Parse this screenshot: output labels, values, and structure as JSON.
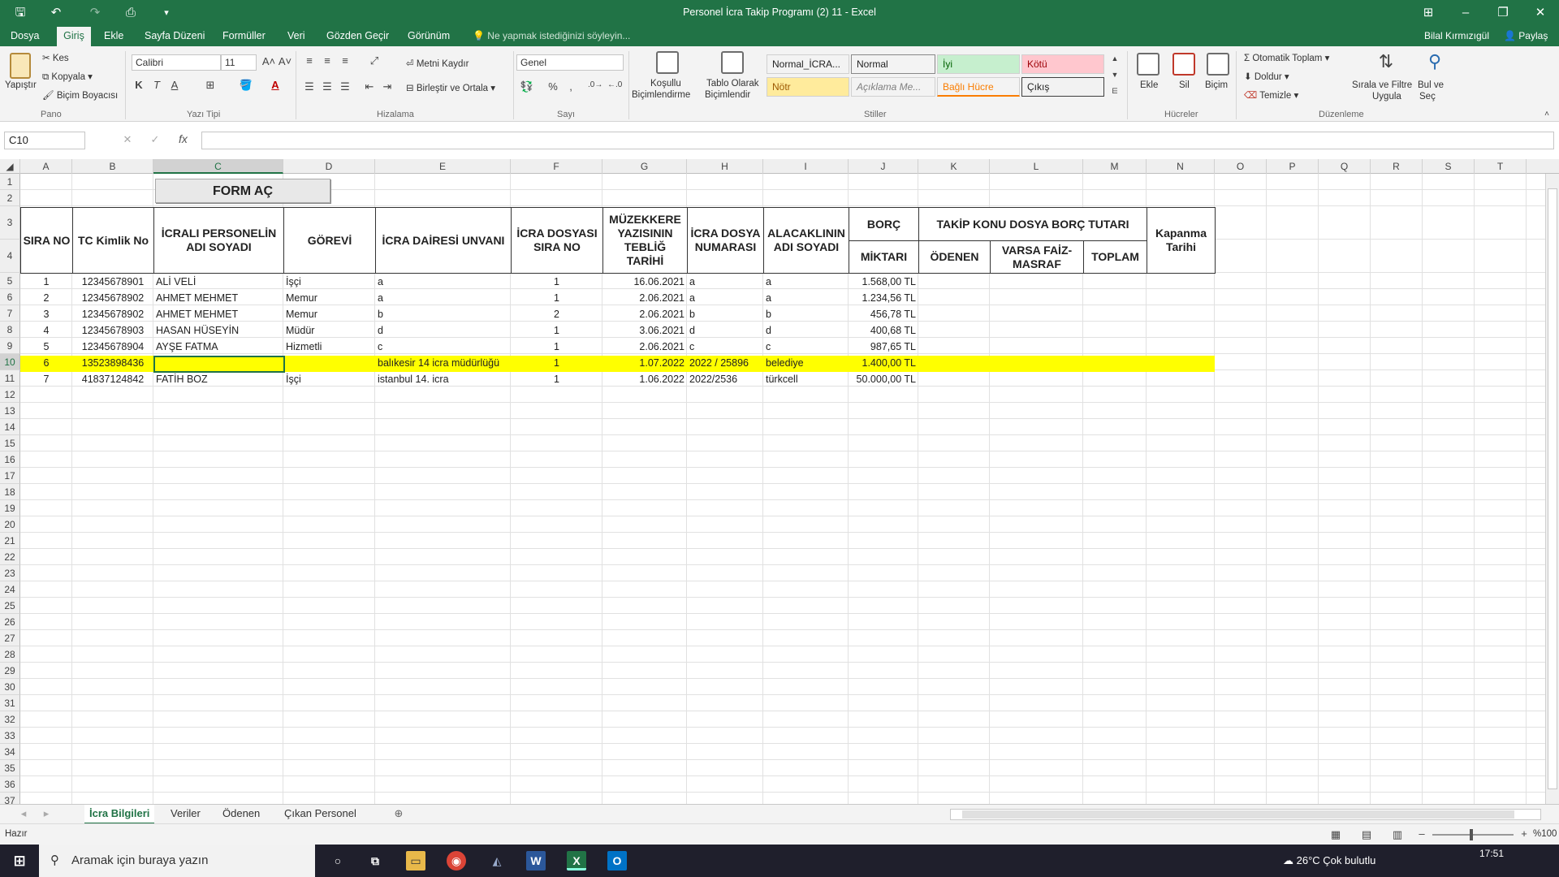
{
  "window": {
    "title": "Personel İcra Takip Programı (2)  11  -  Excel",
    "quick_access": {
      "save": "save-icon",
      "undo": "undo-icon",
      "redo": "redo-icon",
      "preview": "print-preview-icon"
    }
  },
  "ribbon_tabs": [
    "Dosya",
    "Giriş",
    "Ekle",
    "Sayfa Düzeni",
    "Formüller",
    "Veri",
    "Gözden Geçir",
    "Görünüm"
  ],
  "tell_me": "Ne yapmak istediğinizi söyleyin...",
  "user": {
    "name": "Bilal Kırmızıgül",
    "share": "Paylaş"
  },
  "ribbon": {
    "clipboard": {
      "paste": "Yapıştır",
      "cut": "Kes",
      "copy": "Kopyala",
      "format_painter": "Biçim Boyacısı",
      "label": "Pano"
    },
    "font": {
      "name": "Calibri",
      "size": "11",
      "bold": "K",
      "italic": "T",
      "underline": "A",
      "label": "Yazı Tipi"
    },
    "alignment": {
      "wrap": "Metni Kaydır",
      "merge": "Birleştir ve Ortala",
      "label": "Hizalama"
    },
    "number": {
      "format": "Genel",
      "percent": "%",
      "comma": ",",
      "label": "Sayı"
    },
    "styles": {
      "conditional": "Koşullu\nBiçimlendirme",
      "conditional_l1": "Koşullu",
      "conditional_l2": "Biçimlendirme",
      "table_l1": "Tablo Olarak",
      "table_l2": "Biçimlendir",
      "cells": [
        {
          "label": "Normal_İCRA...",
          "bg": "#ffffff"
        },
        {
          "label": "Normal",
          "bg": "#ffffff"
        },
        {
          "label": "İyi",
          "bg": "#c6efce",
          "color": "#006100"
        },
        {
          "label": "Kötü",
          "bg": "#ffc7ce",
          "color": "#9c0006"
        },
        {
          "label": "Nötr",
          "bg": "#ffeb9c",
          "color": "#9c5700"
        },
        {
          "label": "Açıklama Me...",
          "bg": "#ffffff",
          "color": "#7f7f7f"
        },
        {
          "label": "Bağlı Hücre",
          "bg": "#ffffff",
          "color": "#fa7d00"
        },
        {
          "label": "Çıkış",
          "bg": "#f2f2f2",
          "color": "#3f3f3f"
        }
      ],
      "label": "Stiller"
    },
    "cells": {
      "insert": "Ekle",
      "delete": "Sil",
      "format": "Biçim",
      "label": "Hücreler"
    },
    "editing": {
      "autosum": "Otomatik Toplam",
      "fill": "Doldur",
      "clear": "Temizle",
      "sort_l1": "Sırala ve Filtre",
      "sort_l2": "Uygula",
      "find_l1": "Bul ve",
      "find_l2": "Seç",
      "label": "Düzenleme"
    }
  },
  "formula_bar": {
    "name_box": "C10",
    "fx": "fx",
    "value": ""
  },
  "columns": [
    "A",
    "B",
    "C",
    "D",
    "E",
    "F",
    "G",
    "H",
    "I",
    "J",
    "K",
    "L",
    "M",
    "N",
    "O",
    "P",
    "Q",
    "R",
    "S",
    "T"
  ],
  "form_button": "FORM AÇ",
  "headers": {
    "sira_no": "SIRA NO",
    "tc": "TC Kimlik No",
    "personel": "İCRALI PERSONELİN ADI SOYADI",
    "gorevi": "GÖREVİ",
    "daire": "İCRA DAİRESİ UNVANI",
    "dosya_sira": "İCRA DOSYASI SIRA NO",
    "muzekkere": "MÜZEKKERE YAZISININ TEBLİĞ TARİHİ",
    "dosya_no": "İCRA DOSYA NUMARASI",
    "alacakli": "ALACAKLININ ADI SOYADI",
    "borc": "BORÇ",
    "miktar": "MİKTARI",
    "takip": "TAKİP KONU DOSYA BORÇ TUTARI",
    "odenen": "ÖDENEN",
    "faiz": "VARSA FAİZ-MASRAF",
    "toplam": "TOPLAM",
    "kapanma": "Kapanma Tarihi"
  },
  "rows": [
    {
      "sira": "1",
      "tc": "12345678901",
      "ad": "ALİ VELİ",
      "gorev": "İşçi",
      "daire": "a",
      "dsira": "1",
      "tarih": "16.06.2021",
      "dno": "a",
      "alacakli": "a",
      "borc": "1.568,00 TL"
    },
    {
      "sira": "2",
      "tc": "12345678902",
      "ad": "AHMET MEHMET",
      "gorev": "Memur",
      "daire": "a",
      "dsira": "1",
      "tarih": "2.06.2021",
      "dno": "a",
      "alacakli": "a",
      "borc": "1.234,56 TL"
    },
    {
      "sira": "3",
      "tc": "12345678902",
      "ad": "AHMET MEHMET",
      "gorev": "Memur",
      "daire": "b",
      "dsira": "2",
      "tarih": "2.06.2021",
      "dno": "b",
      "alacakli": "b",
      "borc": "456,78 TL"
    },
    {
      "sira": "4",
      "tc": "12345678903",
      "ad": "HASAN HÜSEYİN",
      "gorev": "Müdür",
      "daire": "d",
      "dsira": "1",
      "tarih": "3.06.2021",
      "dno": "d",
      "alacakli": "d",
      "borc": "400,68 TL"
    },
    {
      "sira": "5",
      "tc": "12345678904",
      "ad": "AYŞE FATMA",
      "gorev": "Hizmetli",
      "daire": "c",
      "dsira": "1",
      "tarih": "2.06.2021",
      "dno": "c",
      "alacakli": "c",
      "borc": "987,65 TL"
    },
    {
      "sira": "6",
      "tc": "13523898436",
      "ad": "",
      "gorev": "",
      "daire": "balıkesir 14 icra müdürlüğü",
      "dsira": "1",
      "tarih": "1.07.2022",
      "dno": "2022 / 25896",
      "alacakli": "belediye",
      "borc": "1.400,00 TL"
    },
    {
      "sira": "7",
      "tc": "41837124842",
      "ad": "FATİH BOZ",
      "gorev": "İşçi",
      "daire": "istanbul 14. icra",
      "dsira": "1",
      "tarih": "1.06.2022",
      "dno": "2022/2536",
      "alacakli": "türkcell",
      "borc": "50.000,00 TL"
    }
  ],
  "row_numbers": [
    "1",
    "2",
    "3",
    "4",
    "5",
    "6",
    "7",
    "8",
    "9",
    "10",
    "11",
    "12",
    "13",
    "14",
    "15",
    "16",
    "17",
    "18",
    "19",
    "20",
    "21",
    "22",
    "23",
    "24",
    "25",
    "26",
    "27",
    "28",
    "29",
    "30",
    "31",
    "32",
    "33",
    "34",
    "35",
    "36",
    "37"
  ],
  "sheet_tabs": [
    "İcra Bilgileri",
    "Veriler",
    "Ödenen",
    "Çıkan Personel"
  ],
  "status": {
    "ready": "Hazır",
    "zoom": "%100"
  },
  "taskbar": {
    "search": "Aramak için buraya yazın",
    "weather": "26°C  Çok bulutlu",
    "time": "17:51"
  },
  "colors": {
    "excel_green": "#217346",
    "highlight": "#ffff00"
  }
}
